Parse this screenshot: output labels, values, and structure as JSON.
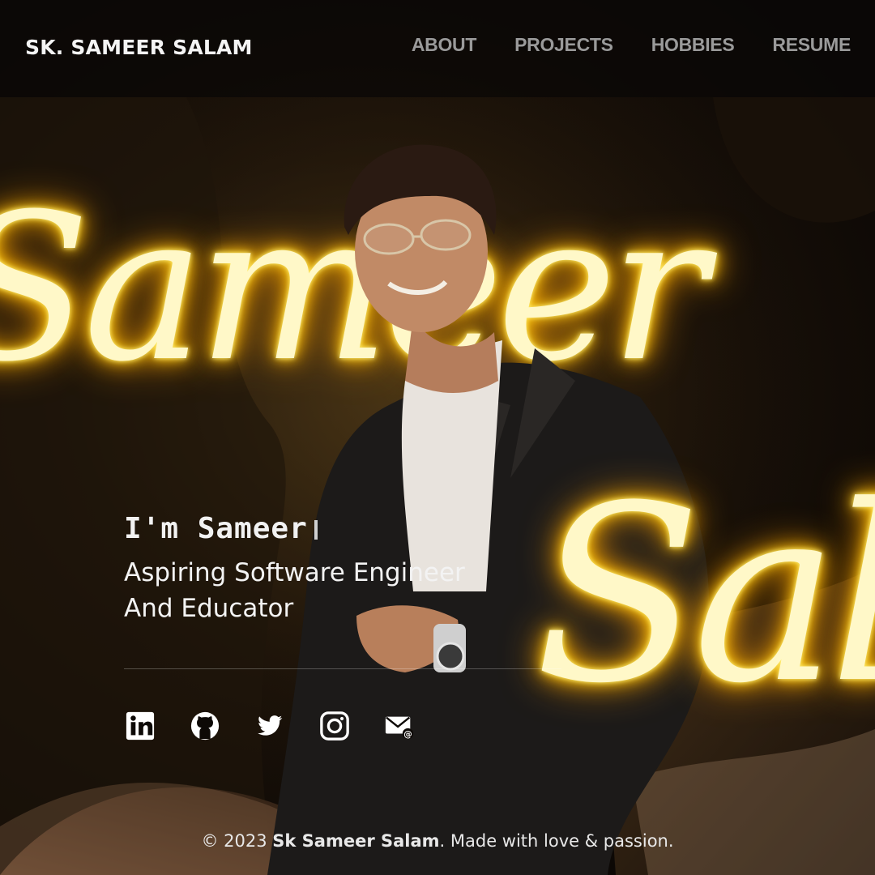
{
  "header": {
    "brand": "SK. SAMEER SALAM",
    "nav": [
      {
        "label": "ABOUT"
      },
      {
        "label": "PROJECTS"
      },
      {
        "label": "HOBBIES"
      },
      {
        "label": "RESUME"
      }
    ]
  },
  "hero": {
    "neon_top": "Sameer",
    "neon_bottom": "Sal",
    "greeting": "I'm Sameer",
    "role_line1": "Aspiring Software Engineer",
    "role_line2": "And Educator"
  },
  "socials": [
    {
      "icon": "linkedin-icon"
    },
    {
      "icon": "github-icon"
    },
    {
      "icon": "twitter-icon"
    },
    {
      "icon": "instagram-icon"
    },
    {
      "icon": "email-icon"
    }
  ],
  "footer": {
    "prefix": "© 2023 ",
    "name": "Sk Sameer Salam",
    "suffix": ". Made with love & passion."
  },
  "colors": {
    "neon": "#ffd21f",
    "background": "#0d0906",
    "nav_text": "#9a9a9a"
  }
}
